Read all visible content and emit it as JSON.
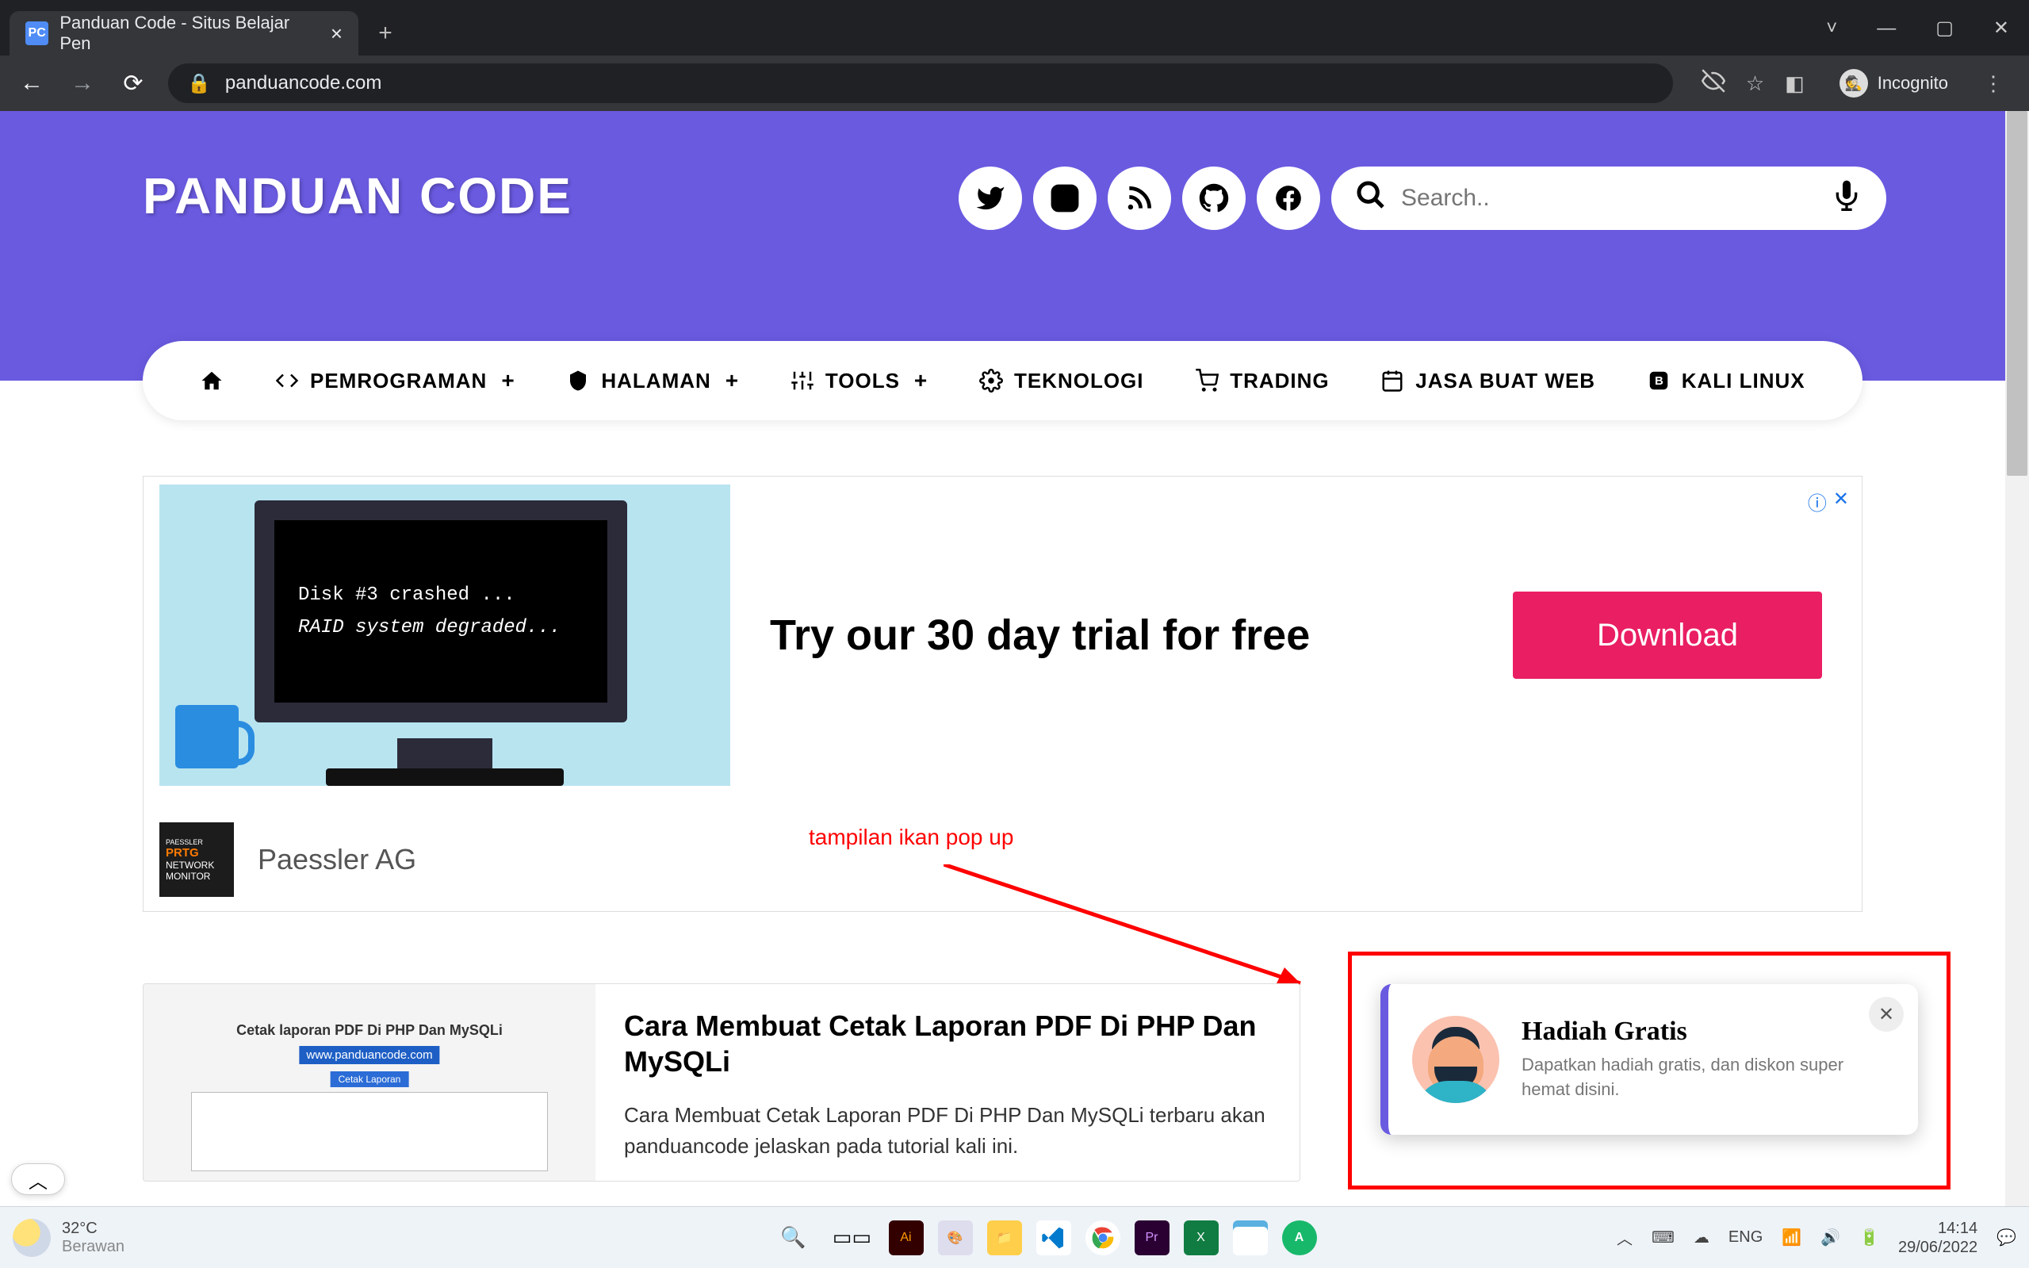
{
  "browser": {
    "tab_title": "Panduan Code - Situs Belajar Pen",
    "favicon_text": "PC",
    "url": "panduancode.com",
    "incognito_label": "Incognito"
  },
  "hero": {
    "brand": "PANDUAN CODE",
    "search_placeholder": "Search.."
  },
  "nav": {
    "items": [
      {
        "label": "",
        "has_sub": false,
        "icon": "home"
      },
      {
        "label": "PEMROGRAMAN",
        "has_sub": true,
        "icon": "code"
      },
      {
        "label": "HALAMAN",
        "has_sub": true,
        "icon": "shield"
      },
      {
        "label": "TOOLS",
        "has_sub": true,
        "icon": "tune"
      },
      {
        "label": "TEKNOLOGI",
        "has_sub": false,
        "icon": "gear"
      },
      {
        "label": "TRADING",
        "has_sub": false,
        "icon": "cart"
      },
      {
        "label": "JASA BUAT WEB",
        "has_sub": false,
        "icon": "calendar"
      },
      {
        "label": "KALI LINUX",
        "has_sub": false,
        "icon": "blog"
      }
    ]
  },
  "ad": {
    "screen_line1": "Disk #3 crashed ...",
    "screen_line2": "RAID system degraded...",
    "title": "Try our 30 day trial for free",
    "button": "Download",
    "brand": "Paessler AG",
    "logo_lines": [
      "PAESSLER",
      "PRTG",
      "NETWORK",
      "MONITOR"
    ]
  },
  "annotation": {
    "text": "tampilan ikan pop up"
  },
  "article": {
    "title": "Cara Membuat Cetak Laporan PDF Di PHP Dan MySQLi",
    "excerpt": "Cara Membuat Cetak Laporan PDF Di PHP Dan MySQLi terbaru akan panduancode jelaskan pada tutorial kali ini.",
    "thumb_heading": "Cetak laporan PDF Di PHP Dan MySQLi",
    "thumb_link": "www.panduancode.com",
    "thumb_button": "Cetak Laporan"
  },
  "popup": {
    "title": "Hadiah Gratis",
    "body": "Dapatkan hadiah gratis, dan diskon super hemat disini."
  },
  "taskbar": {
    "temp": "32°C",
    "weather": "Berawan",
    "lang": "ENG",
    "time": "14:14",
    "date": "29/06/2022"
  }
}
